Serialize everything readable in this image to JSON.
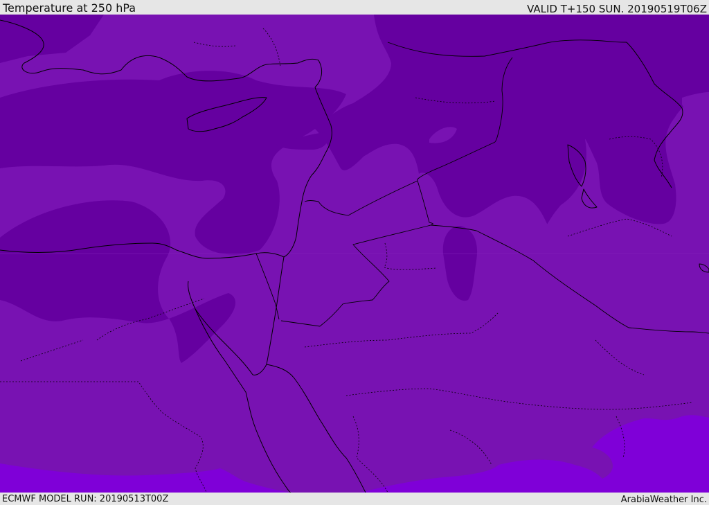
{
  "header": {
    "title": "Temperature at 250 hPa",
    "valid_time": "VALID T+150 SUN. 20190519T06Z"
  },
  "footer": {
    "model_run": "ECMWF MODEL RUN: 20190513T00Z",
    "credit": "ArabiaWeather Inc."
  },
  "colors": {
    "band_cold": "#6500a0",
    "band_mid": "#7812b2",
    "band_warm": "#7f00d8",
    "lines": "#000000",
    "frame": "#e6e6e6"
  }
}
